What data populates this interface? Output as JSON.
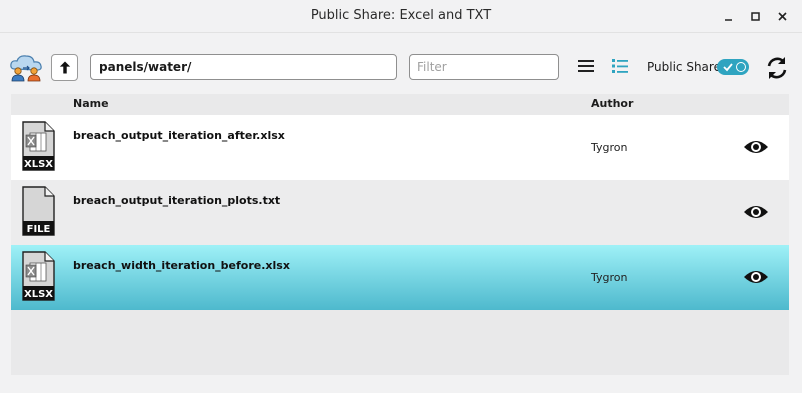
{
  "window": {
    "title": "Public Share: Excel and TXT"
  },
  "toolbar": {
    "path_value": "panels/water/",
    "filter_placeholder": "Filter",
    "public_share_label": "Public Share",
    "public_share_enabled": true,
    "accent_color": "#2fa4c0"
  },
  "table": {
    "columns": {
      "name": "Name",
      "author": "Author"
    },
    "rows": [
      {
        "icon": "xlsx-file-icon",
        "icon_label": "XLSX",
        "name": "breach_output_iteration_after.xlsx",
        "author": "Tygron",
        "selected": false
      },
      {
        "icon": "generic-file-icon",
        "icon_label": "FILE",
        "name": "breach_output_iteration_plots.txt",
        "author": "",
        "selected": false
      },
      {
        "icon": "xlsx-file-icon",
        "icon_label": "XLSX",
        "name": "breach_width_iteration_before.xlsx",
        "author": "Tygron",
        "selected": true
      }
    ]
  }
}
